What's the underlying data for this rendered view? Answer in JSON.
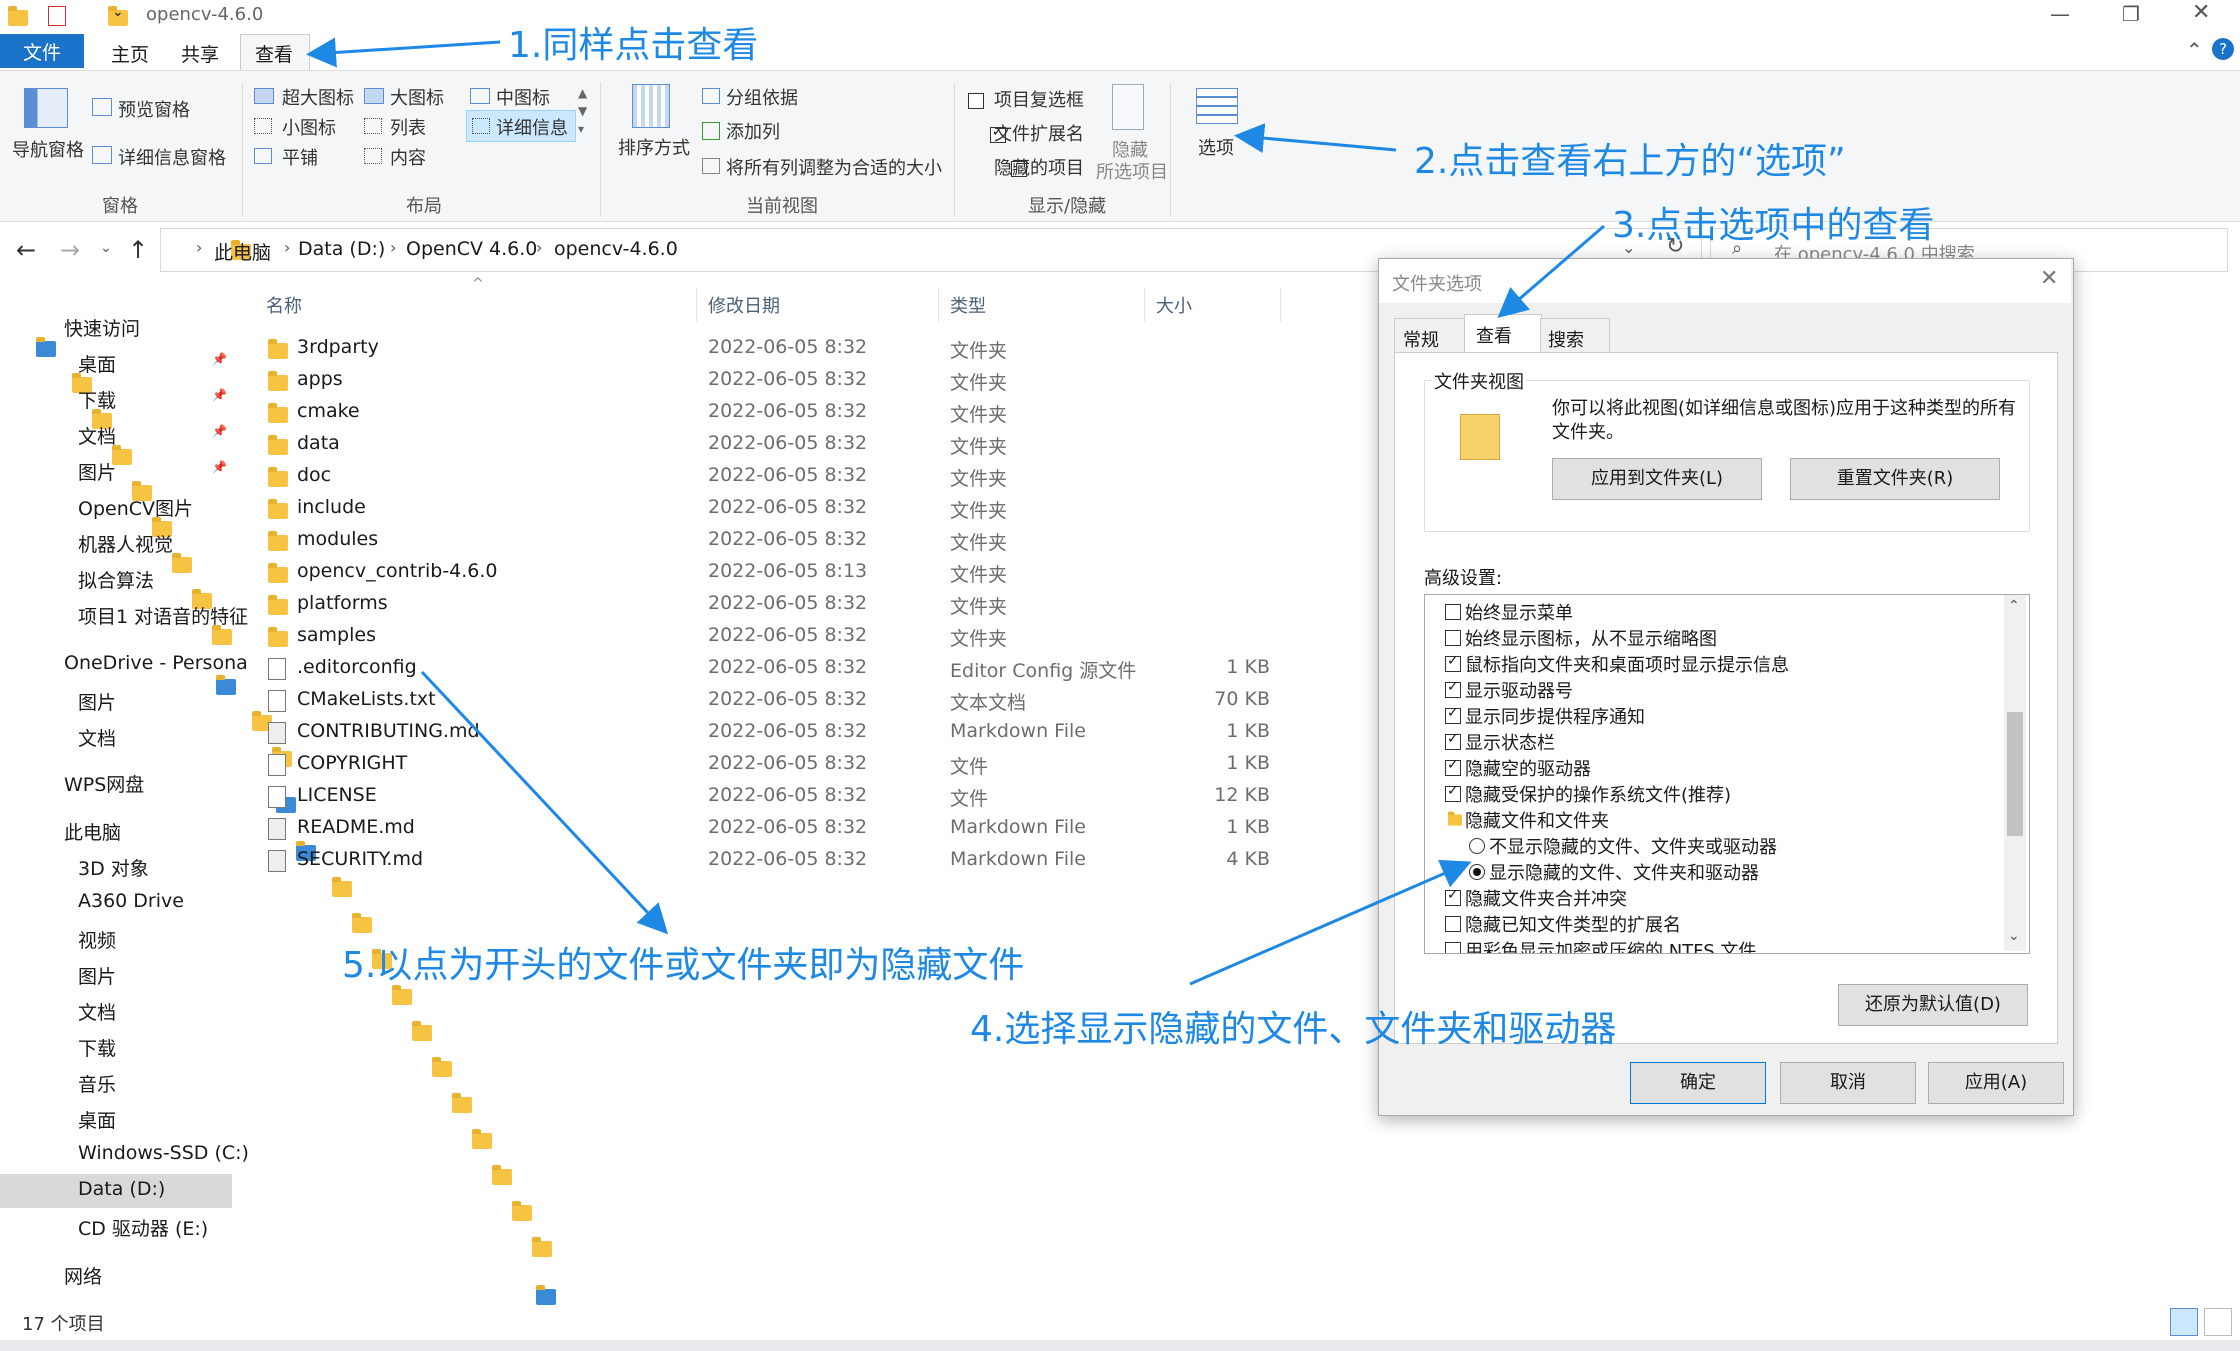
{
  "window": {
    "title": "opencv-4.6.0"
  },
  "tabs": [
    {
      "label": "文件"
    },
    {
      "label": "主页"
    },
    {
      "label": "共享"
    },
    {
      "label": "查看"
    }
  ],
  "ribbon": {
    "panes": {
      "nav_pane": "导航窗格",
      "preview": "预览窗格",
      "details": "详细信息窗格",
      "title": "窗格"
    },
    "layout": {
      "xl": "超大图标",
      "l": "大图标",
      "m": "中图标",
      "s": "小图标",
      "list": "列表",
      "details": "详细信息",
      "tiles": "平铺",
      "content": "内容",
      "title": "布局"
    },
    "current": {
      "sort": "排序方式",
      "group": "分组依据",
      "add_col": "添加列",
      "fit": "将所有列调整为合适的大小",
      "title": "当前视图"
    },
    "show": {
      "item_cb": "项目复选框",
      "ext": "文件扩展名",
      "hidden": "隐藏的项目",
      "hide_sel1": "隐藏",
      "hide_sel2": "所选项目",
      "title": "显示/隐藏"
    },
    "options": "选项"
  },
  "address": {
    "parts": [
      "此电脑",
      "Data (D:)",
      "OpenCV 4.6.0",
      "opencv-4.6.0"
    ],
    "search_placeholder": "在 opencv-4.6.0 中搜索"
  },
  "columns": {
    "name": "名称",
    "date": "修改日期",
    "type": "类型",
    "size": "大小"
  },
  "files": [
    {
      "name": "3rdparty",
      "date": "2022-06-05 8:32",
      "type": "文件夹",
      "size": "",
      "icon": "folder"
    },
    {
      "name": "apps",
      "date": "2022-06-05 8:32",
      "type": "文件夹",
      "size": "",
      "icon": "folder"
    },
    {
      "name": "cmake",
      "date": "2022-06-05 8:32",
      "type": "文件夹",
      "size": "",
      "icon": "folder"
    },
    {
      "name": "data",
      "date": "2022-06-05 8:32",
      "type": "文件夹",
      "size": "",
      "icon": "folder"
    },
    {
      "name": "doc",
      "date": "2022-06-05 8:32",
      "type": "文件夹",
      "size": "",
      "icon": "folder"
    },
    {
      "name": "include",
      "date": "2022-06-05 8:32",
      "type": "文件夹",
      "size": "",
      "icon": "folder"
    },
    {
      "name": "modules",
      "date": "2022-06-05 8:32",
      "type": "文件夹",
      "size": "",
      "icon": "folder"
    },
    {
      "name": "opencv_contrib-4.6.0",
      "date": "2022-06-05 8:13",
      "type": "文件夹",
      "size": "",
      "icon": "folder"
    },
    {
      "name": "platforms",
      "date": "2022-06-05 8:32",
      "type": "文件夹",
      "size": "",
      "icon": "folder"
    },
    {
      "name": "samples",
      "date": "2022-06-05 8:32",
      "type": "文件夹",
      "size": "",
      "icon": "folder"
    },
    {
      "name": ".editorconfig",
      "date": "2022-06-05 8:32",
      "type": "Editor Config 源文件",
      "size": "1 KB",
      "icon": "file"
    },
    {
      "name": "CMakeLists.txt",
      "date": "2022-06-05 8:32",
      "type": "文本文档",
      "size": "70 KB",
      "icon": "file"
    },
    {
      "name": "CONTRIBUTING.md",
      "date": "2022-06-05 8:32",
      "type": "Markdown File",
      "size": "1 KB",
      "icon": "md"
    },
    {
      "name": "COPYRIGHT",
      "date": "2022-06-05 8:32",
      "type": "文件",
      "size": "1 KB",
      "icon": "file"
    },
    {
      "name": "LICENSE",
      "date": "2022-06-05 8:32",
      "type": "文件",
      "size": "12 KB",
      "icon": "file"
    },
    {
      "name": "README.md",
      "date": "2022-06-05 8:32",
      "type": "Markdown File",
      "size": "1 KB",
      "icon": "md"
    },
    {
      "name": "SECURITY.md",
      "date": "2022-06-05 8:32",
      "type": "Markdown File",
      "size": "4 KB",
      "icon": "md"
    }
  ],
  "nav": [
    {
      "label": "快速访问",
      "level": 0
    },
    {
      "label": "桌面",
      "level": 1
    },
    {
      "label": "下载",
      "level": 1
    },
    {
      "label": "文档",
      "level": 1
    },
    {
      "label": "图片",
      "level": 1
    },
    {
      "label": "OpenCV图片",
      "level": 1
    },
    {
      "label": "机器人视觉",
      "level": 1
    },
    {
      "label": "拟合算法",
      "level": 1
    },
    {
      "label": "项目1 对语音的特征",
      "level": 1
    },
    {
      "label": "OneDrive - Persona",
      "level": 0
    },
    {
      "label": "图片",
      "level": 1
    },
    {
      "label": "文档",
      "level": 1
    },
    {
      "label": "WPS网盘",
      "level": 0
    },
    {
      "label": "此电脑",
      "level": 0
    },
    {
      "label": "3D 对象",
      "level": 1
    },
    {
      "label": "A360 Drive",
      "level": 1
    },
    {
      "label": "视频",
      "level": 1
    },
    {
      "label": "图片",
      "level": 1
    },
    {
      "label": "文档",
      "level": 1
    },
    {
      "label": "下载",
      "level": 1
    },
    {
      "label": "音乐",
      "level": 1
    },
    {
      "label": "桌面",
      "level": 1
    },
    {
      "label": "Windows-SSD (C:)",
      "level": 1
    },
    {
      "label": "Data (D:)",
      "level": 1
    },
    {
      "label": "CD 驱动器 (E:)",
      "level": 1
    },
    {
      "label": "网络",
      "level": 0
    }
  ],
  "status": {
    "count": "17 个项目"
  },
  "dialog": {
    "title": "文件夹选项",
    "tabs": [
      "常规",
      "查看",
      "搜索"
    ],
    "folder_view": {
      "title": "文件夹视图",
      "desc1": "你可以将此视图(如详细信息或图标)应用于这种类型的所有",
      "desc2": "文件夹。",
      "apply": "应用到文件夹(L)",
      "reset": "重置文件夹(R)"
    },
    "advanced_title": "高级设置:",
    "advanced": [
      {
        "label": "始终显示菜单",
        "kind": "cb",
        "on": false
      },
      {
        "label": "始终显示图标，从不显示缩略图",
        "kind": "cb",
        "on": false
      },
      {
        "label": "鼠标指向文件夹和桌面项时显示提示信息",
        "kind": "cb",
        "on": true
      },
      {
        "label": "显示驱动器号",
        "kind": "cb",
        "on": true
      },
      {
        "label": "显示同步提供程序通知",
        "kind": "cb",
        "on": true
      },
      {
        "label": "显示状态栏",
        "kind": "cb",
        "on": true
      },
      {
        "label": "隐藏空的驱动器",
        "kind": "cb",
        "on": true
      },
      {
        "label": "隐藏受保护的操作系统文件(推荐)",
        "kind": "cb",
        "on": true
      },
      {
        "label": "隐藏文件和文件夹",
        "kind": "folder",
        "on": false
      },
      {
        "label": "不显示隐藏的文件、文件夹或驱动器",
        "kind": "radio",
        "on": false
      },
      {
        "label": "显示隐藏的文件、文件夹和驱动器",
        "kind": "radio",
        "on": true
      },
      {
        "label": "隐藏文件夹合并冲突",
        "kind": "cb",
        "on": true
      },
      {
        "label": "隐藏已知文件类型的扩展名",
        "kind": "cb",
        "on": false
      },
      {
        "label": "用彩色显示加密或压缩的 NTFS 文件",
        "kind": "cb",
        "on": false
      }
    ],
    "restore": "还原为默认值(D)",
    "ok": "确定",
    "cancel": "取消",
    "apply": "应用(A)"
  },
  "annotations": {
    "a1": "1.同样点击查看",
    "a2": "2.点击查看右上方的“选项”",
    "a3": "3.点击选项中的查看",
    "a4": "4.选择显示隐藏的文件、文件夹和驱动器",
    "a5": "5.以点为开头的文件或文件夹即为隐藏文件"
  },
  "colors": {
    "accent": "#1e88e5",
    "file_tab": "#1a73c8",
    "selected": "#cce8ff"
  }
}
